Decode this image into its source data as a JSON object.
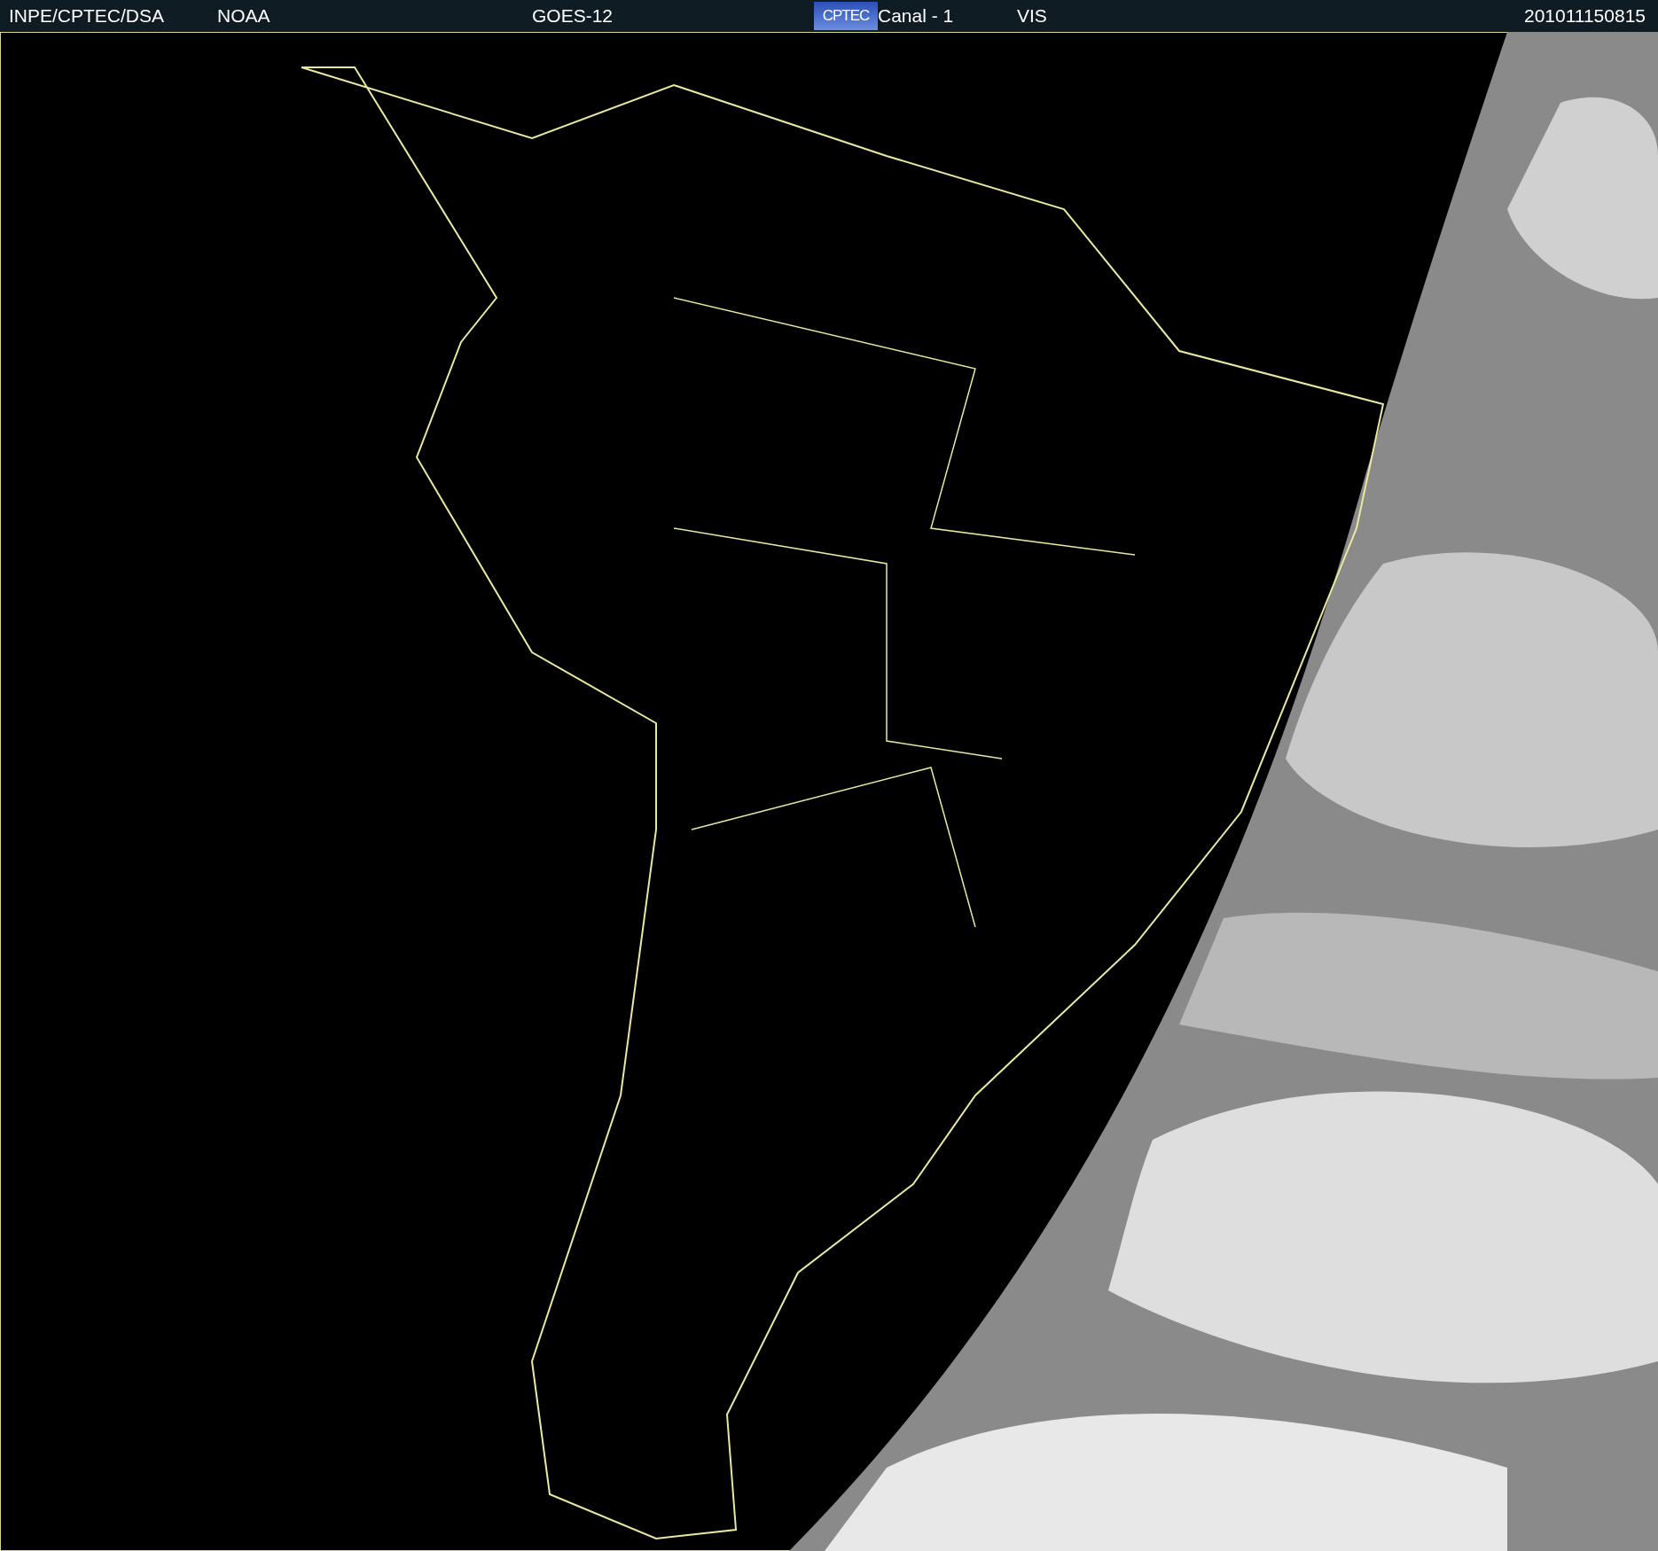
{
  "header": {
    "agency": "INPE/CPTEC/DSA",
    "source": "NOAA",
    "satellite": "GOES-12",
    "logo": "CPTEC",
    "channel": "Canal - 1",
    "band": "VIS",
    "timestamp": "201011150815"
  }
}
